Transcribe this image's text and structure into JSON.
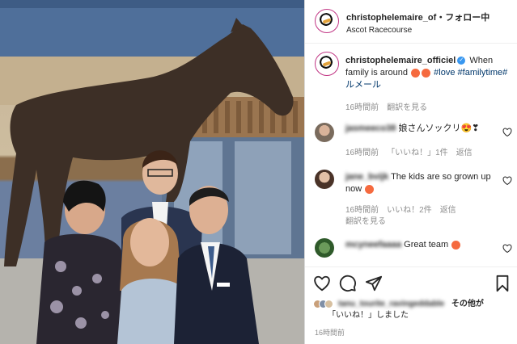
{
  "header": {
    "username": "christophelemaire_of",
    "dot": "・",
    "follow_label": "フォロー中",
    "location": "Ascot Racecourse",
    "more_label": "···"
  },
  "caption": {
    "username": "christophelemaire_officiel",
    "text_part1": "When family is around",
    "hashtag_love": "#love",
    "hashtag_familytime": "#familytime",
    "hashtag_jp": "#ルメール",
    "time": "16時間前",
    "translate_label": "翻訳を見る"
  },
  "comments": [
    {
      "username": "jasmeeco38",
      "text": "娘さんソックリ😍❣",
      "time": "16時間前",
      "likes": "「いいね！」1件",
      "reply_label": "返信"
    },
    {
      "username": "jane_bvijk",
      "text": "The kids are so grown up now",
      "time": "16時間前",
      "likes": "いいね！2件",
      "reply_label": "返信",
      "translate_label": "翻訳を見る"
    },
    {
      "username": "mcyneefaaaa",
      "text": "Great team"
    }
  ],
  "likes_line": {
    "username": "tanu_tourite_ravingeddable",
    "suffix_other": "その他が",
    "suffix_liked": "「いいね！」しました"
  },
  "post_time": "16時間前",
  "colors": {
    "accent_link": "#00376b",
    "verified": "#3897f0",
    "meta_grey": "#8e8e8e"
  },
  "icons": [
    "more-icon",
    "verified-icon",
    "heart-icon",
    "comment-icon",
    "share-icon",
    "bookmark-icon"
  ]
}
